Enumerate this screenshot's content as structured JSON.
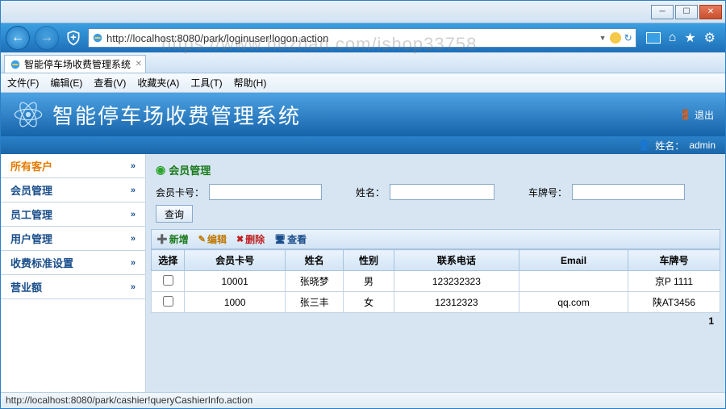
{
  "window": {
    "min": "─",
    "max": "☐",
    "close": "✕"
  },
  "nav": {
    "back": "←",
    "fwd": "→",
    "url": "http://localhost:8080/park/loginuser!logon.action"
  },
  "tab": {
    "title": "智能停车场收费管理系统"
  },
  "menu": {
    "file": "文件(F)",
    "edit": "编辑(E)",
    "view": "查看(V)",
    "fav": "收藏夹(A)",
    "tools": "工具(T)",
    "help": "帮助(H)"
  },
  "app": {
    "title": "智能停车场收费管理系统",
    "logout": "退出",
    "username_label": "姓名：",
    "username": "admin"
  },
  "sidebar": {
    "items": [
      {
        "label": "所有客户",
        "active": true
      },
      {
        "label": "会员管理",
        "active": false
      },
      {
        "label": "员工管理",
        "active": false
      },
      {
        "label": "用户管理",
        "active": false
      },
      {
        "label": "收费标准设置",
        "active": false
      },
      {
        "label": "营业额",
        "active": false
      }
    ],
    "arrow": "»"
  },
  "panel": {
    "title": "会员管理"
  },
  "search": {
    "card_label": "会员卡号：",
    "name_label": "姓名：",
    "plate_label": "车牌号：",
    "query_btn": "查询"
  },
  "toolbar": {
    "add": "新增",
    "edit": "编辑",
    "del": "删除",
    "view": "查看"
  },
  "grid": {
    "headers": {
      "sel": "选择",
      "card": "会员卡号",
      "name": "姓名",
      "gender": "性别",
      "phone": "联系电话",
      "email": "Email",
      "plate": "车牌号"
    },
    "rows": [
      {
        "card": "10001",
        "name": "张晓梦",
        "gender": "男",
        "phone": "123232323",
        "email": "",
        "plate": "京P 1111"
      },
      {
        "card": "1000",
        "name": "张三丰",
        "gender": "女",
        "phone": "12312323",
        "email": "qq.com",
        "plate": "陕AT3456"
      }
    ]
  },
  "pager": {
    "page": "1"
  },
  "statusbar": {
    "text": "http://localhost:8080/park/cashier!queryCashierInfo.action"
  },
  "watermark": "https://www.huzhan.com/ishop33758"
}
